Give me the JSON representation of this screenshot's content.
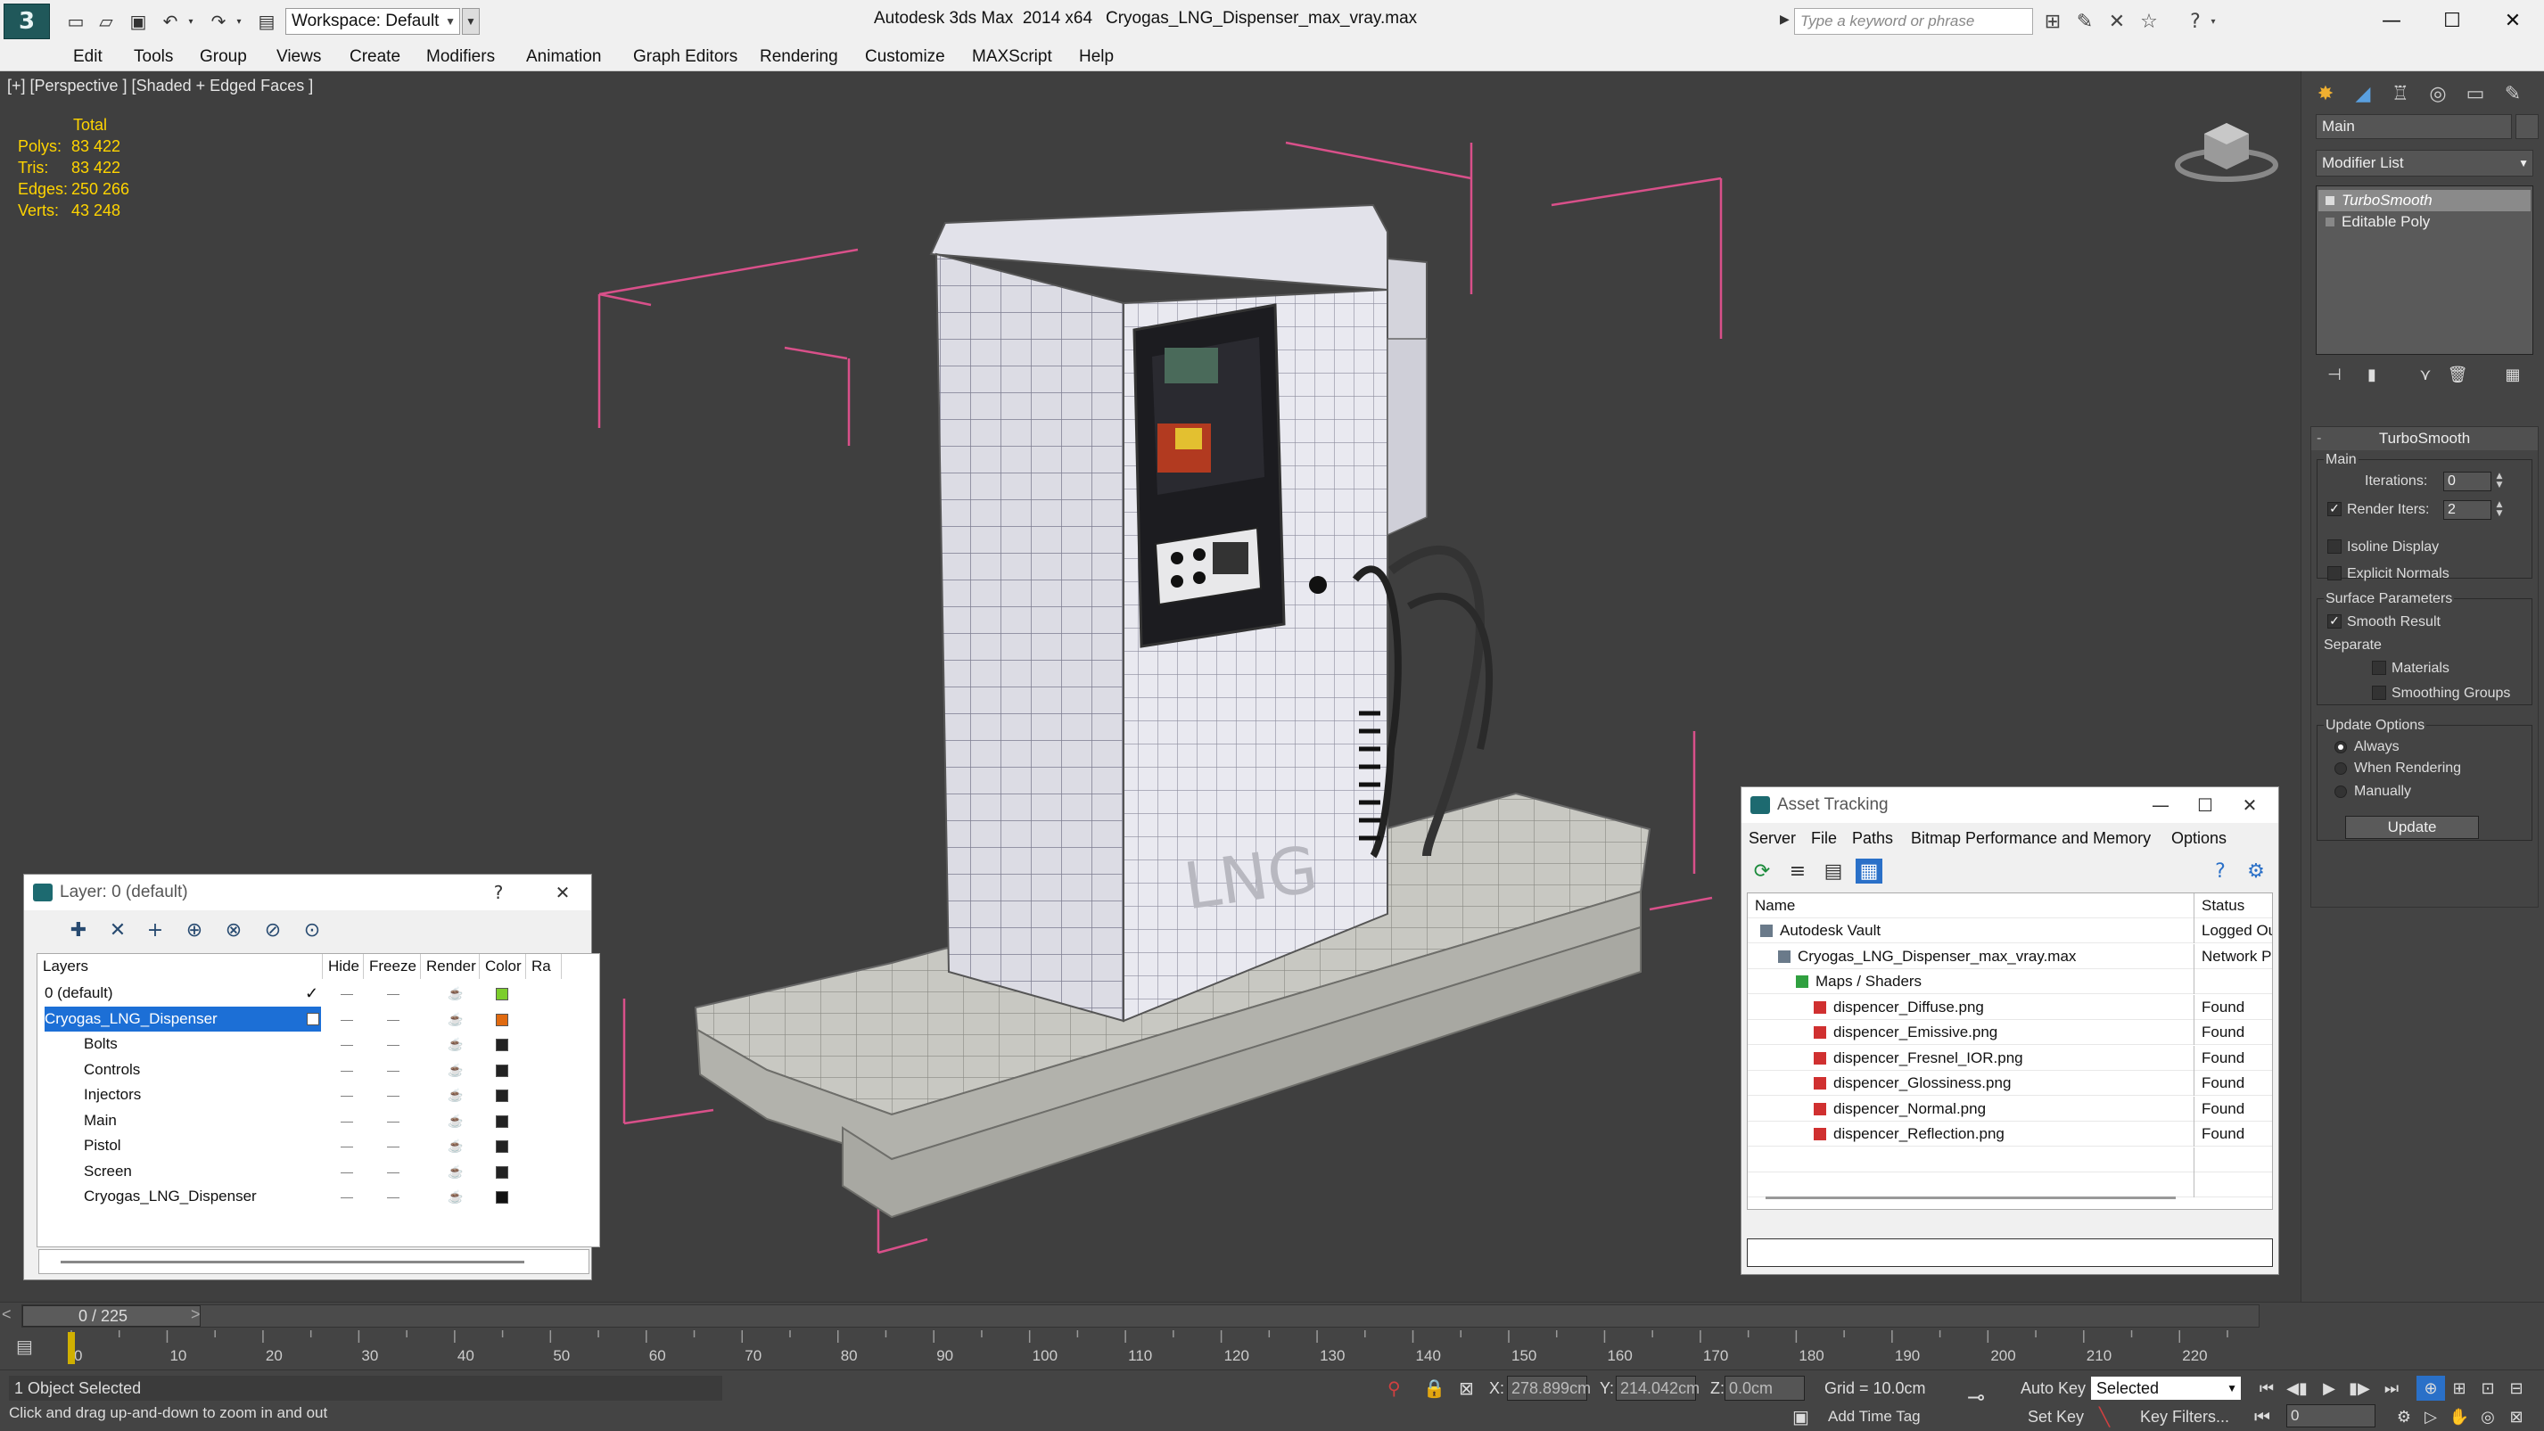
{
  "titlebar": {
    "logo_letter": "3",
    "workspace": "Workspace: Default",
    "app_title": "Autodesk 3ds Max  2014 x64",
    "file_title": "Cryogas_LNG_Dispenser_max_vray.max",
    "search_placeholder": "Type a keyword or phrase"
  },
  "menu": [
    "Edit",
    "Tools",
    "Group",
    "Views",
    "Create",
    "Modifiers",
    "Animation",
    "Graph Editors",
    "Rendering",
    "Customize",
    "MAXScript",
    "Help"
  ],
  "viewport": {
    "label": "[+] [Perspective ] [Shaded + Edged Faces ]",
    "stats": {
      "header": "Total",
      "rows": [
        {
          "label": "Polys:",
          "value": "83 422"
        },
        {
          "label": "Tris:",
          "value": "83 422"
        },
        {
          "label": "Edges:",
          "value": "250 266"
        },
        {
          "label": "Verts:",
          "value": "43 248"
        }
      ]
    },
    "model_text": "LNG"
  },
  "layer_window": {
    "title": "Layer: 0 (default)",
    "help": "?",
    "columns": [
      "Layers",
      "Hide",
      "Freeze",
      "Render",
      "Color",
      "Ra"
    ],
    "rows": [
      {
        "name": "0 (default)",
        "color": "#7ccd2c",
        "selected": false
      },
      {
        "name": "Cryogas_LNG_Dispenser",
        "color": "#e06a10",
        "selected": true
      },
      {
        "name": "Bolts",
        "color": "#222222",
        "selected": false
      },
      {
        "name": "Controls",
        "color": "#222222",
        "selected": false
      },
      {
        "name": "Injectors",
        "color": "#222222",
        "selected": false
      },
      {
        "name": "Main",
        "color": "#222222",
        "selected": false
      },
      {
        "name": "Pistol",
        "color": "#222222",
        "selected": false
      },
      {
        "name": "Screen",
        "color": "#222222",
        "selected": false
      },
      {
        "name": "Cryogas_LNG_Dispenser",
        "color": "#111111",
        "selected": false
      }
    ]
  },
  "asset_window": {
    "title": "Asset Tracking",
    "menu": [
      "Server",
      "File",
      "Paths",
      "Bitmap Performance and Memory",
      "Options"
    ],
    "columns": [
      "Name",
      "Status"
    ],
    "rows": [
      {
        "name": "Autodesk Vault",
        "status": "Logged Ou",
        "indent": 0
      },
      {
        "name": "Cryogas_LNG_Dispenser_max_vray.max",
        "status": "Network P",
        "indent": 1
      },
      {
        "name": "Maps / Shaders",
        "status": "",
        "indent": 2
      },
      {
        "name": "dispencer_Diffuse.png",
        "status": "Found",
        "indent": 3
      },
      {
        "name": "dispencer_Emissive.png",
        "status": "Found",
        "indent": 3
      },
      {
        "name": "dispencer_Fresnel_IOR.png",
        "status": "Found",
        "indent": 3
      },
      {
        "name": "dispencer_Glossiness.png",
        "status": "Found",
        "indent": 3
      },
      {
        "name": "dispencer_Normal.png",
        "status": "Found",
        "indent": 3
      },
      {
        "name": "dispencer_Reflection.png",
        "status": "Found",
        "indent": 3
      }
    ]
  },
  "command_panel": {
    "object_name": "Main",
    "modifier_list": "Modifier List",
    "stack": [
      "TurboSmooth",
      "Editable Poly"
    ],
    "rollout": {
      "title": "TurboSmooth",
      "main_group": "Main",
      "iterations_label": "Iterations:",
      "iterations_value": "0",
      "render_iters_label": "Render Iters:",
      "render_iters_value": "2",
      "isoline": "Isoline Display",
      "explicit": "Explicit Normals",
      "surface_group": "Surface Parameters",
      "smooth_result": "Smooth Result",
      "separate": "Separate",
      "materials": "Materials",
      "smoothing_groups": "Smoothing Groups",
      "update_group": "Update Options",
      "always": "Always",
      "when_rendering": "When Rendering",
      "manually": "Manually",
      "update_btn": "Update"
    }
  },
  "timeline": {
    "frame": "0 / 225",
    "ticks": [
      "0",
      "10",
      "20",
      "30",
      "40",
      "50",
      "60",
      "70",
      "80",
      "90",
      "100",
      "110",
      "120",
      "130",
      "140",
      "150",
      "160",
      "170",
      "180",
      "190",
      "200",
      "210",
      "220"
    ]
  },
  "status": {
    "selected": "1 Object Selected",
    "prompt": "Click and drag up-and-down to zoom in and out",
    "x_label": "X:",
    "x_value": "278.899cm",
    "y_label": "Y:",
    "y_value": "214.042cm",
    "z_label": "Z:",
    "z_value": "0.0cm",
    "grid": "Grid = 10.0cm",
    "add_time_tag": "Add Time Tag",
    "auto_key": "Auto Key",
    "set_key": "Set Key",
    "selected_dd": "Selected",
    "key_filters": "Key Filters...",
    "frame_value": "0"
  },
  "colors": {
    "viewport_bg": "#3f3f3f",
    "stats_yellow": "#ffd400",
    "selection_blue": "#1c6fd6",
    "bbox_pink": "#d9508a"
  }
}
